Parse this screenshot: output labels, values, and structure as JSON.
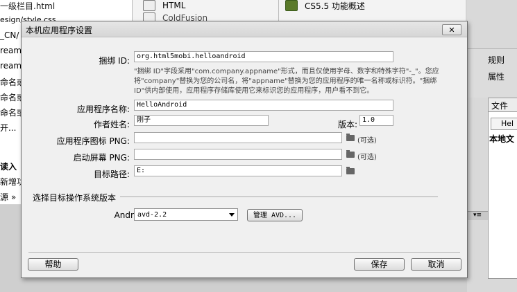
{
  "background": {
    "left_items": [
      "一级栏目.html",
      "esign/style.css",
      "_CN/",
      "reamW",
      "reamW",
      "命名或",
      "命名或",
      "命名或",
      "开...",
      "读入",
      "新增功",
      "源 »"
    ],
    "mid_items": [
      "HTML",
      "CS5.5 功能概述",
      "ColdFusion"
    ],
    "right_labels": [
      "规则",
      "属性",
      "文件",
      "Hel",
      "本地文"
    ]
  },
  "dialog": {
    "title": "本机应用程序设置",
    "close_label": "✕",
    "bundle_id_label": "捆绑 ID:",
    "bundle_id_value": "org.html5mobi.helloandroid",
    "hint": "\"捆绑 ID\"字段采用\"com.company.appname\"形式，而且仅使用字母、数字和特殊字符\"-_\"。您应将\"company\"替换为您的公司名，将\"appname\"替换为您的应用程序的唯一名称或标识符。\"捆绑 ID\"供内部使用，应用程序存储库使用它来标识您的应用程序，用户看不到它。",
    "app_name_label": "应用程序名称:",
    "app_name_value": "HelloAndroid",
    "author_label": "作者姓名:",
    "author_value": "刚子",
    "version_label": "版本:",
    "version_value": "1.0",
    "icon_label": "应用程序图标 PNG:",
    "icon_value": "",
    "icon_optional": "(可选)",
    "splash_label": "启动屏幕 PNG:",
    "splash_value": "",
    "splash_optional": "(可选)",
    "target_label": "目标路径:",
    "target_value": "E:",
    "os_group_label": "选择目标操作系统版本",
    "android_label": "Android:",
    "android_value": "avd-2.2",
    "manage_avd_label": "管理 AVD...",
    "help_label": "帮助",
    "save_label": "保存",
    "cancel_label": "取消"
  }
}
